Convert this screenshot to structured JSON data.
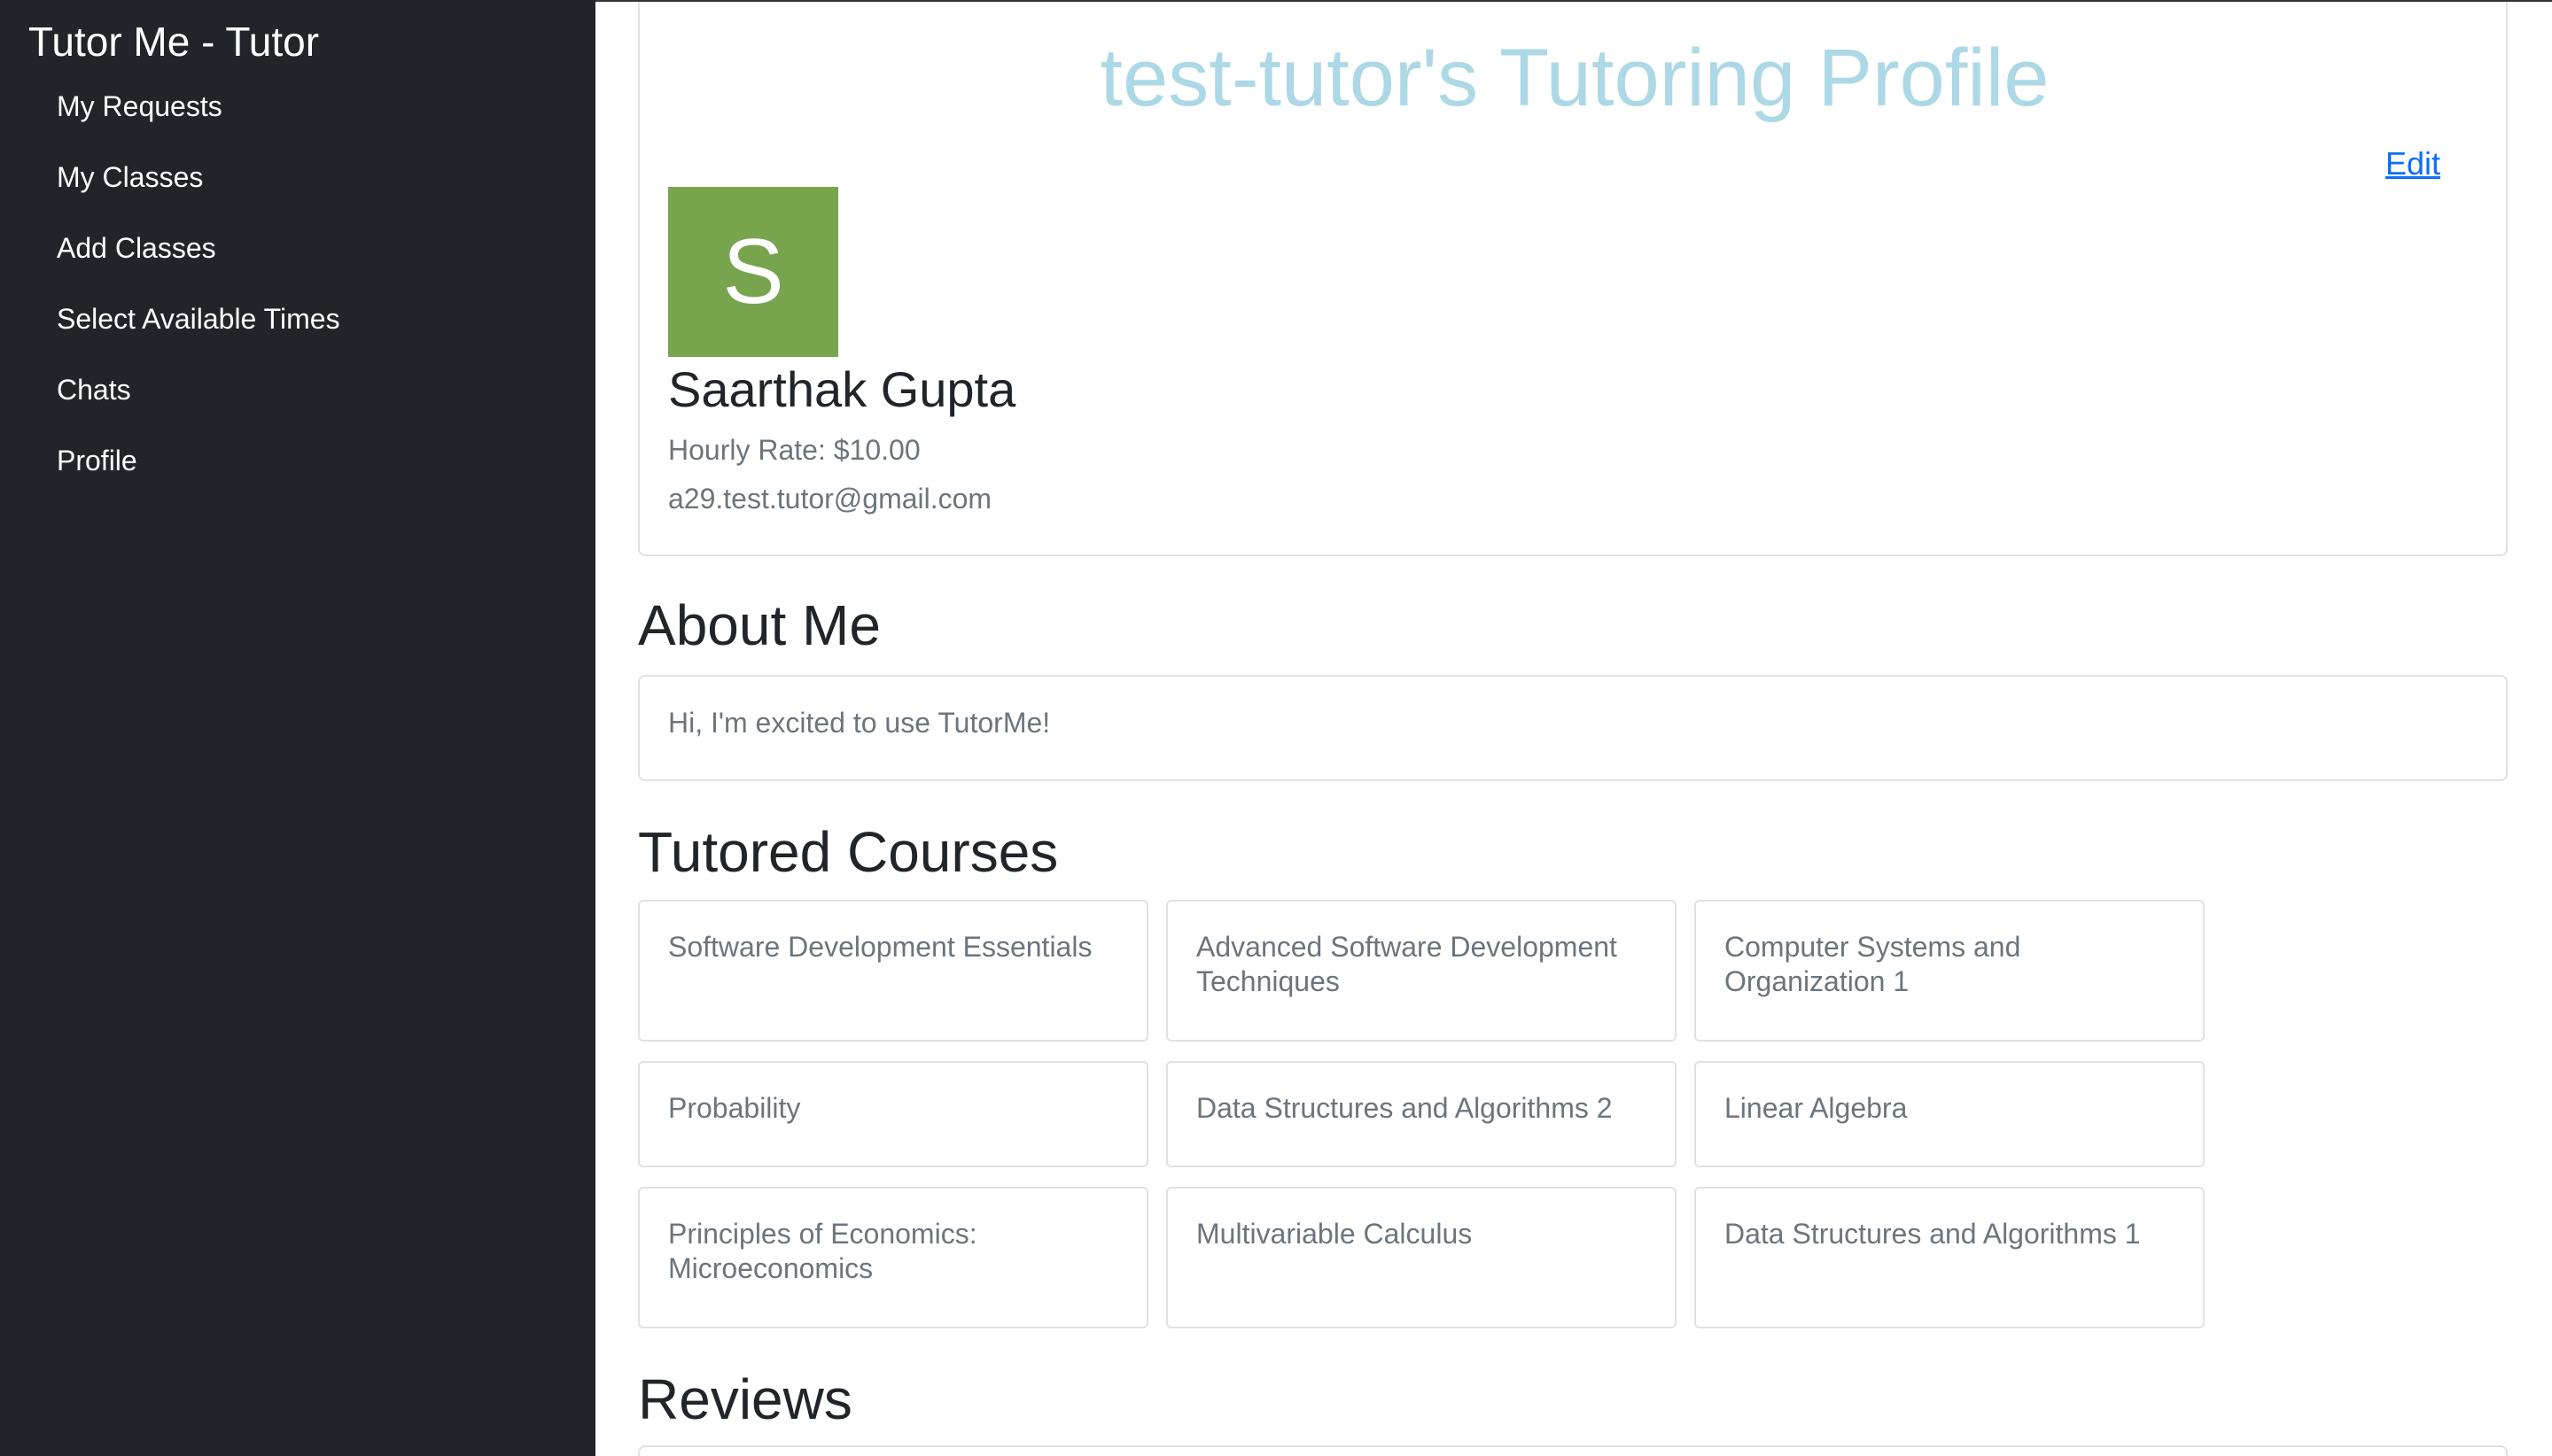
{
  "sidebar": {
    "brand": "Tutor Me - Tutor",
    "items": [
      {
        "label": "My Requests"
      },
      {
        "label": "My Classes"
      },
      {
        "label": "Add Classes"
      },
      {
        "label": "Select Available Times"
      },
      {
        "label": "Chats"
      },
      {
        "label": "Profile"
      }
    ]
  },
  "profile": {
    "title": "test-tutor's Tutoring Profile",
    "edit_label": "Edit",
    "avatar_initial": "S",
    "avatar_color": "#79a44e",
    "name": "Saarthak Gupta",
    "hourly_rate": "Hourly Rate: $10.00",
    "email": "a29.test.tutor@gmail.com"
  },
  "about": {
    "heading": "About Me",
    "text": "Hi, I'm excited to use TutorMe!"
  },
  "courses": {
    "heading": "Tutored Courses",
    "items": [
      {
        "title": "Software Development Essentials"
      },
      {
        "title": "Advanced Software Development Techniques"
      },
      {
        "title": "Computer Systems and Organization 1"
      },
      {
        "title": "Probability"
      },
      {
        "title": "Data Structures and Algorithms 2"
      },
      {
        "title": "Linear Algebra"
      },
      {
        "title": "Principles of Economics: Microeconomics"
      },
      {
        "title": "Multivariable Calculus"
      },
      {
        "title": "Data Structures and Algorithms 1"
      }
    ]
  },
  "reviews": {
    "heading": "Reviews"
  },
  "colors": {
    "sidebar_bg": "#212529",
    "title_color": "#add8e6",
    "link_color": "#0d6efd"
  }
}
